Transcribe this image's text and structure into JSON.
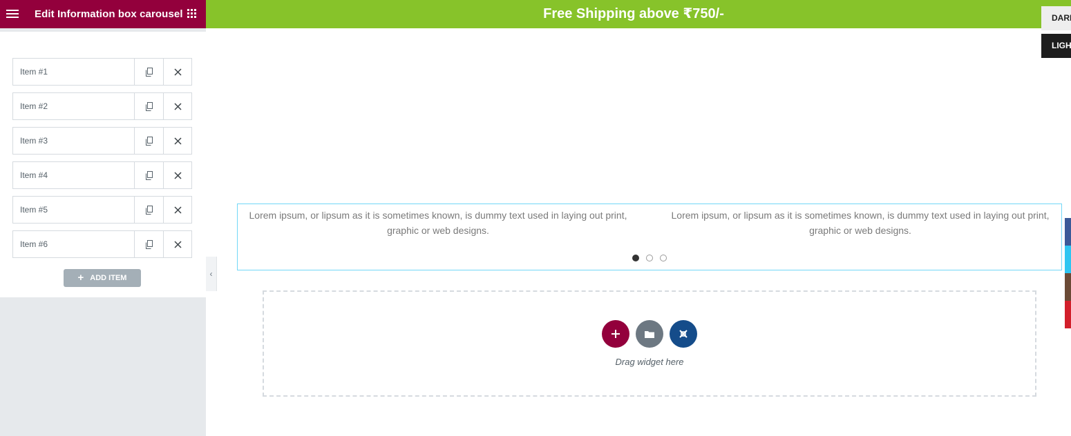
{
  "editor": {
    "panel_title": "Edit Information box carousel",
    "items": [
      {
        "label": "Item #1"
      },
      {
        "label": "Item #2"
      },
      {
        "label": "Item #3"
      },
      {
        "label": "Item #4"
      },
      {
        "label": "Item #5"
      },
      {
        "label": "Item #6"
      }
    ],
    "add_item_label": "ADD ITEM"
  },
  "preview": {
    "shipping_banner": "Free Shipping above ₹750/-",
    "mode_switch": {
      "dark": "DARK",
      "light": "LIGHT"
    },
    "carousel": {
      "slides": [
        "Lorem ipsum, or lipsum as it is sometimes known, is dummy text used in laying out print, graphic or web designs.",
        "Lorem ipsum, or lipsum as it is sometimes known, is dummy text used in laying out print, graphic or web designs."
      ],
      "pagination": {
        "count": 3,
        "active": 1
      }
    },
    "dropzone": {
      "hint": "Drag widget here"
    }
  },
  "icons": {
    "menu": "hamburger-icon",
    "widgets": "grid-icon",
    "duplicate": "copy-icon",
    "remove": "close-icon",
    "collapse": "chevron-left-icon",
    "add_section": "plus-icon",
    "add_template": "folder-icon",
    "extension": "puzzle-icon"
  },
  "colors": {
    "brand": "#93003c",
    "banner": "#87c32a",
    "carousel_border": "#71d7f7",
    "add_section": "#93003c",
    "add_template": "#6d7882",
    "extension_button": "#154c8a",
    "social": [
      "#3b5998",
      "#2ec5f1",
      "#6b4a36",
      "#d21f2b"
    ]
  }
}
